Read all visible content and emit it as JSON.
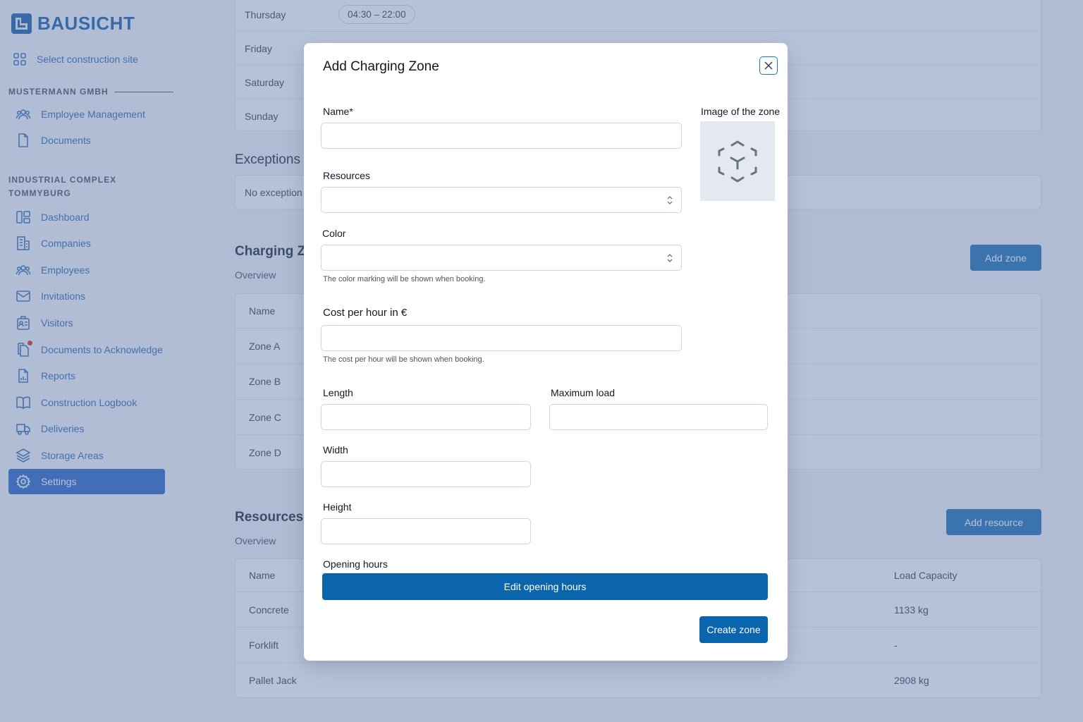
{
  "brand": {
    "name": "BAUSICHT"
  },
  "sidebar": {
    "site_select": "Select construction site",
    "company_label": "MUSTERMANN GMBH",
    "company_items": [
      {
        "label": "Employee Management",
        "icon": "users-icon"
      },
      {
        "label": "Documents",
        "icon": "document-icon"
      }
    ],
    "site_label": "INDUSTRIAL COMPLEX TOMMYBURG",
    "site_items": [
      {
        "label": "Dashboard",
        "icon": "dashboard-icon"
      },
      {
        "label": "Companies",
        "icon": "building-icon"
      },
      {
        "label": "Employees",
        "icon": "users-icon"
      },
      {
        "label": "Invitations",
        "icon": "mail-icon"
      },
      {
        "label": "Visitors",
        "icon": "badge-icon"
      },
      {
        "label": "Documents to Acknowledge",
        "icon": "documents-icon",
        "notification": true
      },
      {
        "label": "Reports",
        "icon": "report-icon"
      },
      {
        "label": "Construction Logbook",
        "icon": "book-icon"
      },
      {
        "label": "Deliveries",
        "icon": "truck-icon"
      },
      {
        "label": "Storage Areas",
        "icon": "layers-icon"
      },
      {
        "label": "Settings",
        "icon": "gear-icon",
        "active": true
      }
    ]
  },
  "main": {
    "hours": [
      {
        "day": "Thursday",
        "time": "04:30 – 22:00"
      },
      {
        "day": "Friday",
        "time": ""
      },
      {
        "day": "Saturday",
        "time": ""
      },
      {
        "day": "Sunday",
        "time": ""
      }
    ],
    "exceptions": {
      "title": "Exceptions",
      "empty": "No exception"
    },
    "zones": {
      "title": "Charging Z",
      "subtitle": "Overview",
      "add_label": "Add zone",
      "col_name": "Name",
      "rows": [
        "Zone A",
        "Zone B",
        "Zone C",
        "Zone D"
      ]
    },
    "resources": {
      "title": "Resources",
      "subtitle": "Overview",
      "add_label": "Add resource",
      "col_name": "Name",
      "col_load": "Load Capacity",
      "rows": [
        {
          "name": "Concrete",
          "load": "1133 kg"
        },
        {
          "name": "Forklift",
          "load": "-"
        },
        {
          "name": "Pallet Jack",
          "load": "2908 kg"
        }
      ]
    }
  },
  "modal": {
    "title": "Add Charging Zone",
    "name_label": "Name*",
    "name_value": "",
    "image_label": "Image of the zone",
    "resources_label": "Resources",
    "color_label": "Color",
    "color_hint": "The color marking will be shown when booking.",
    "cost_label": "Cost per hour in €",
    "cost_hint": "The cost per hour will be shown when booking.",
    "length_label": "Length",
    "max_load_label": "Maximum load",
    "width_label": "Width",
    "height_label": "Height",
    "opening_hours_label": "Opening hours",
    "edit_hours_button": "Edit opening hours",
    "create_button": "Create zone"
  },
  "colors": {
    "primary": "#0b65ad",
    "brand": "#1d5fa8",
    "active_nav": "#2a66c4",
    "notification": "#d92d20"
  }
}
